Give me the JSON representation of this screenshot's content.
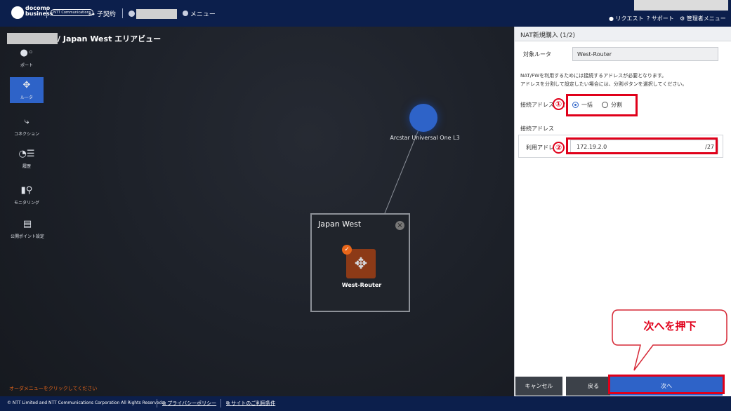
{
  "header": {
    "brand_line1": "docomo",
    "brand_line2": "business",
    "ntt_logo_text": "NTT Communications",
    "contract_label": "子契約",
    "menu_label": "メニュー",
    "request_label": "リクエスト",
    "support_label": "サポート",
    "admin_label": "管理者メニュー"
  },
  "breadcrumb": {
    "text": "/ Japan West エリアビュー"
  },
  "sidebar": {
    "items": [
      {
        "label": "ポート",
        "icon": "port-icon",
        "glyph": "●◦"
      },
      {
        "label": "ルータ",
        "icon": "router-icon",
        "glyph": "✥"
      },
      {
        "label": "コネクション",
        "icon": "connection-icon",
        "glyph": "⤷"
      },
      {
        "label": "履歴",
        "icon": "history-icon",
        "glyph": "◔☰"
      },
      {
        "label": "モニタリング",
        "icon": "monitoring-icon",
        "glyph": "▮⚲"
      },
      {
        "label": "公開ポイント設定",
        "icon": "public-point-icon",
        "glyph": "▤"
      }
    ]
  },
  "map": {
    "cloud_node_label": "Arcstar Universal One L3",
    "area_title": "Japan West",
    "router_label": "West-Router",
    "order_hint": "オーダメニューをクリックしてください"
  },
  "panel": {
    "title": "NAT新規購入 (1/2)",
    "target_router_label": "対象ルータ",
    "target_router_value": "West-Router",
    "description_line1": "NAT/FWを利用するためには接続するアドレスが必要となります。",
    "description_line2": "アドレスを分割して設定したい場合には、分割ボタンを選択してください。",
    "address_setting_label": "接続アドレス設定",
    "radio_option1": "一括",
    "radio_option2": "分割",
    "radio_selected": "一括",
    "address_section_label": "接続アドレス",
    "usable_address_label": "利用アドレス",
    "address_value": "172.19.2.0",
    "prefix_value": "/27"
  },
  "buttons": {
    "cancel": "キャンセル",
    "back": "戻る",
    "next": "次へ"
  },
  "annotations": {
    "step1": "①",
    "step2": "②",
    "callout": "次へを押下"
  },
  "footer": {
    "copyright": "© NTT Limited and NTT Communications Corporation All Rights Reserved.",
    "privacy_link": "プライバシーポリシー",
    "terms_link": "サイトのご利用条件"
  },
  "colors": {
    "header_bg": "#0c1f4c",
    "accent_blue": "#2e63c8",
    "annotation_red": "#e0001a",
    "order_hint": "#e8661a"
  }
}
